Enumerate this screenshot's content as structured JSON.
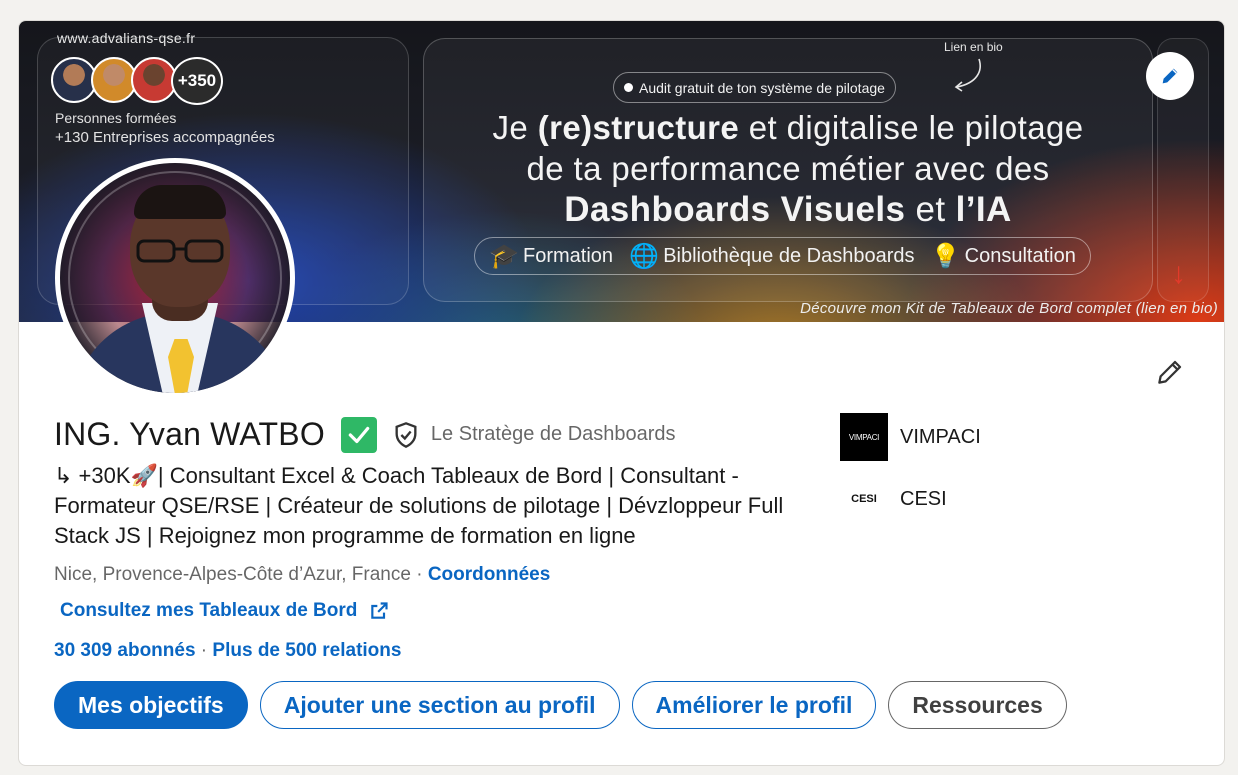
{
  "banner": {
    "site_url": "www.advalians-qse.fr",
    "avatar_count": "+350",
    "trained_label": "Personnes formées",
    "companies_label": "+130 Entreprises accompagnées",
    "lien_bio": "Lien en bio",
    "audit_pill": "Audit gratuit de ton système de pilotage",
    "headline_line1_pre": "Je ",
    "headline_line1_bold": "(re)structure",
    "headline_line1_post": " et digitalise le pilotage",
    "headline_line2": "de ta performance métier avec des",
    "headline_line3_bold": "Dashboards Visuels",
    "headline_line3_mid": " et ",
    "headline_line3_bold2": "l’IA",
    "features": [
      "Formation",
      "Bibliothèque de Dashboards",
      "Consultation"
    ],
    "caption": "Découvre mon Kit de Tableaux de Bord complet (lien en bio)"
  },
  "profile": {
    "name": "ING. Yvan WATBO",
    "pronoun_badge": "Le Stratège de Dashboards",
    "headline": "↳ +30K🚀| Consultant Excel & Coach Tableaux de Bord | Consultant - Formateur QSE/RSE | Créateur de solutions de pilotage | Dévzloppeur Full Stack JS | Rejoignez mon programme de formation en ligne",
    "location": "Nice, Provence-Alpes-Côte d’Azur, France",
    "location_sep": " · ",
    "contact_link": "Coordonnées",
    "website_label": "Consultez mes Tableaux de Bord",
    "followers": "30 309 abonnés",
    "stats_sep": " · ",
    "connections": "Plus de 500 relations"
  },
  "orgs": [
    {
      "name": "VIMPACI",
      "logo_text": "VIMPACI"
    },
    {
      "name": "CESI",
      "logo_text": "CESI"
    }
  ],
  "actions": {
    "primary": "Mes objectifs",
    "add_section": "Ajouter une section au profil",
    "improve": "Améliorer le profil",
    "resources": "Ressources"
  },
  "colors": {
    "brand_blue": "#0a66c2",
    "verified_green": "#2fb866"
  }
}
